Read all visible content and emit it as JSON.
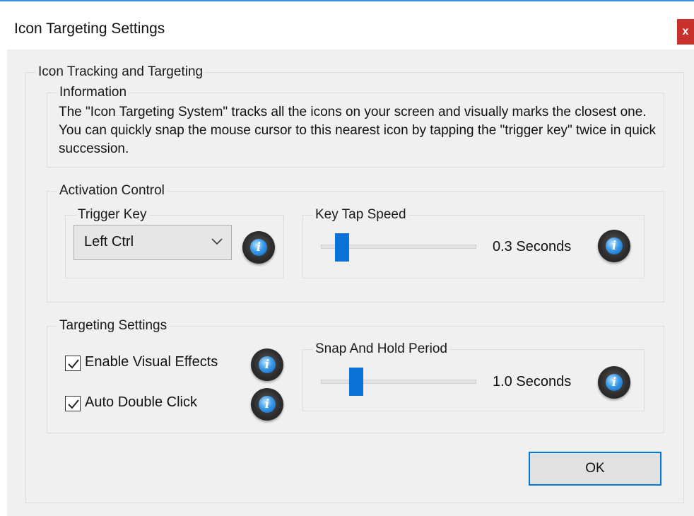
{
  "window": {
    "title": "Icon Targeting Settings",
    "close_label": "x"
  },
  "main_group": {
    "label": "Icon Tracking and Targeting"
  },
  "information": {
    "label": "Information",
    "text": "The \"Icon Targeting System\" tracks all the icons on your screen and visually marks the closest one. You can quickly snap the mouse cursor to this nearest icon by tapping the \"trigger key\" twice in quick succession."
  },
  "activation": {
    "label": "Activation Control",
    "trigger_key": {
      "label": "Trigger Key",
      "value": "Left Ctrl",
      "info_icon": "info-icon"
    },
    "key_tap_speed": {
      "label": "Key Tap Speed",
      "value": "0.3 Seconds",
      "slider_fraction": 0.1,
      "info_icon": "info-icon"
    }
  },
  "targeting": {
    "label": "Targeting Settings",
    "visual_effects": {
      "label": "Enable Visual Effects",
      "checked": true
    },
    "auto_double_click": {
      "label": "Auto Double Click",
      "checked": true
    },
    "snap_hold": {
      "label": "Snap And Hold Period",
      "value": "1.0 Seconds",
      "slider_fraction": 0.2
    }
  },
  "ok_label": "OK",
  "colors": {
    "accent": "#0078d7",
    "slider": "#0a72d6",
    "close": "#c8302b"
  }
}
